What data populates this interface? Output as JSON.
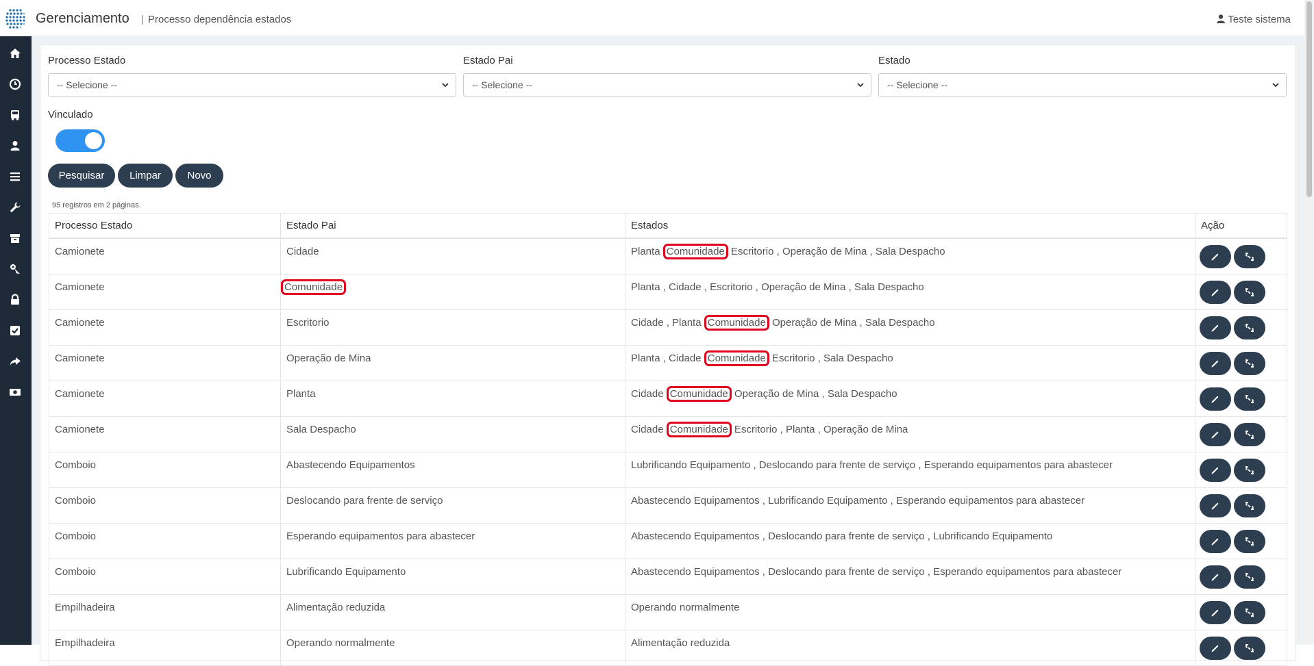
{
  "header": {
    "app_title": "Gerenciamento",
    "separator": "|",
    "page_title": "Processo dependência estados",
    "user_name": "Teste sistema"
  },
  "sidebar": {
    "icons": [
      "home-icon",
      "clock-icon",
      "bus-icon",
      "user-icon",
      "list-icon",
      "wrench-icon",
      "archive-icon",
      "key-icon",
      "lock-icon",
      "checkbox-icon",
      "share-icon",
      "money-icon"
    ]
  },
  "filters": {
    "processo_estado": {
      "label": "Processo Estado",
      "value": "-- Selecione --"
    },
    "estado_pai": {
      "label": "Estado Pai",
      "value": "-- Selecione --"
    },
    "estado": {
      "label": "Estado",
      "value": "-- Selecione --"
    },
    "vinculado": {
      "label": "Vinculado",
      "on": true
    }
  },
  "buttons": {
    "pesquisar": "Pesquisar",
    "limpar": "Limpar",
    "novo": "Novo"
  },
  "records_info": "95 registros em 2 páginas.",
  "table": {
    "headers": [
      "Processo Estado",
      "Estado Pai",
      "Estados",
      "Ação"
    ],
    "rows": [
      {
        "processo": "Camionete",
        "pai": "Cidade",
        "pai_hl": false,
        "estados_pre": "Planta ",
        "estados_hl": "Comunidade",
        "estados_post": " Escritorio , Operação de Mina , Sala Despacho"
      },
      {
        "processo": "Camionete",
        "pai": "Comunidade",
        "pai_hl": true,
        "estados_pre": "Planta , Cidade , Escritorio , Operação de Mina , Sala Despacho",
        "estados_hl": "",
        "estados_post": ""
      },
      {
        "processo": "Camionete",
        "pai": "Escritorio",
        "pai_hl": false,
        "estados_pre": "Cidade , Planta ",
        "estados_hl": "Comunidade",
        "estados_post": " Operação de Mina , Sala Despacho"
      },
      {
        "processo": "Camionete",
        "pai": "Operação de Mina",
        "pai_hl": false,
        "estados_pre": "Planta , Cidade ",
        "estados_hl": "Comunidade",
        "estados_post": " Escritorio , Sala Despacho"
      },
      {
        "processo": "Camionete",
        "pai": "Planta",
        "pai_hl": false,
        "estados_pre": "Cidade ",
        "estados_hl": "Comunidade",
        "estados_post": " Operação de Mina , Sala Despacho"
      },
      {
        "processo": "Camionete",
        "pai": "Sala Despacho",
        "pai_hl": false,
        "estados_pre": "Cidade ",
        "estados_hl": "Comunidade",
        "estados_post": " Escritorio , Planta , Operação de Mina"
      },
      {
        "processo": "Comboio",
        "pai": "Abastecendo Equipamentos",
        "pai_hl": false,
        "estados_pre": "Lubrificando Equipamento , Deslocando para frente de serviço , Esperando equipamentos para abastecer",
        "estados_hl": "",
        "estados_post": ""
      },
      {
        "processo": "Comboio",
        "pai": "Deslocando para frente de serviço",
        "pai_hl": false,
        "estados_pre": "Abastecendo Equipamentos , Lubrificando Equipamento , Esperando equipamentos para abastecer",
        "estados_hl": "",
        "estados_post": ""
      },
      {
        "processo": "Comboio",
        "pai": "Esperando equipamentos para abastecer",
        "pai_hl": false,
        "estados_pre": "Abastecendo Equipamentos , Deslocando para frente de serviço , Lubrificando Equipamento",
        "estados_hl": "",
        "estados_post": ""
      },
      {
        "processo": "Comboio",
        "pai": "Lubrificando Equipamento",
        "pai_hl": false,
        "estados_pre": "Abastecendo Equipamentos , Deslocando para frente de serviço , Esperando equipamentos para abastecer",
        "estados_hl": "",
        "estados_post": ""
      },
      {
        "processo": "Empilhadeira",
        "pai": "Alimentação reduzida",
        "pai_hl": false,
        "estados_pre": "Operando normalmente",
        "estados_hl": "",
        "estados_post": ""
      },
      {
        "processo": "Empilhadeira",
        "pai": "Operando normalmente",
        "pai_hl": false,
        "estados_pre": "Alimentação reduzida",
        "estados_hl": "",
        "estados_post": ""
      }
    ]
  },
  "colors": {
    "sidebar": "#1f2a38",
    "button": "#2c3e50",
    "toggle": "#2f93f2",
    "highlight": "#e0001b"
  }
}
